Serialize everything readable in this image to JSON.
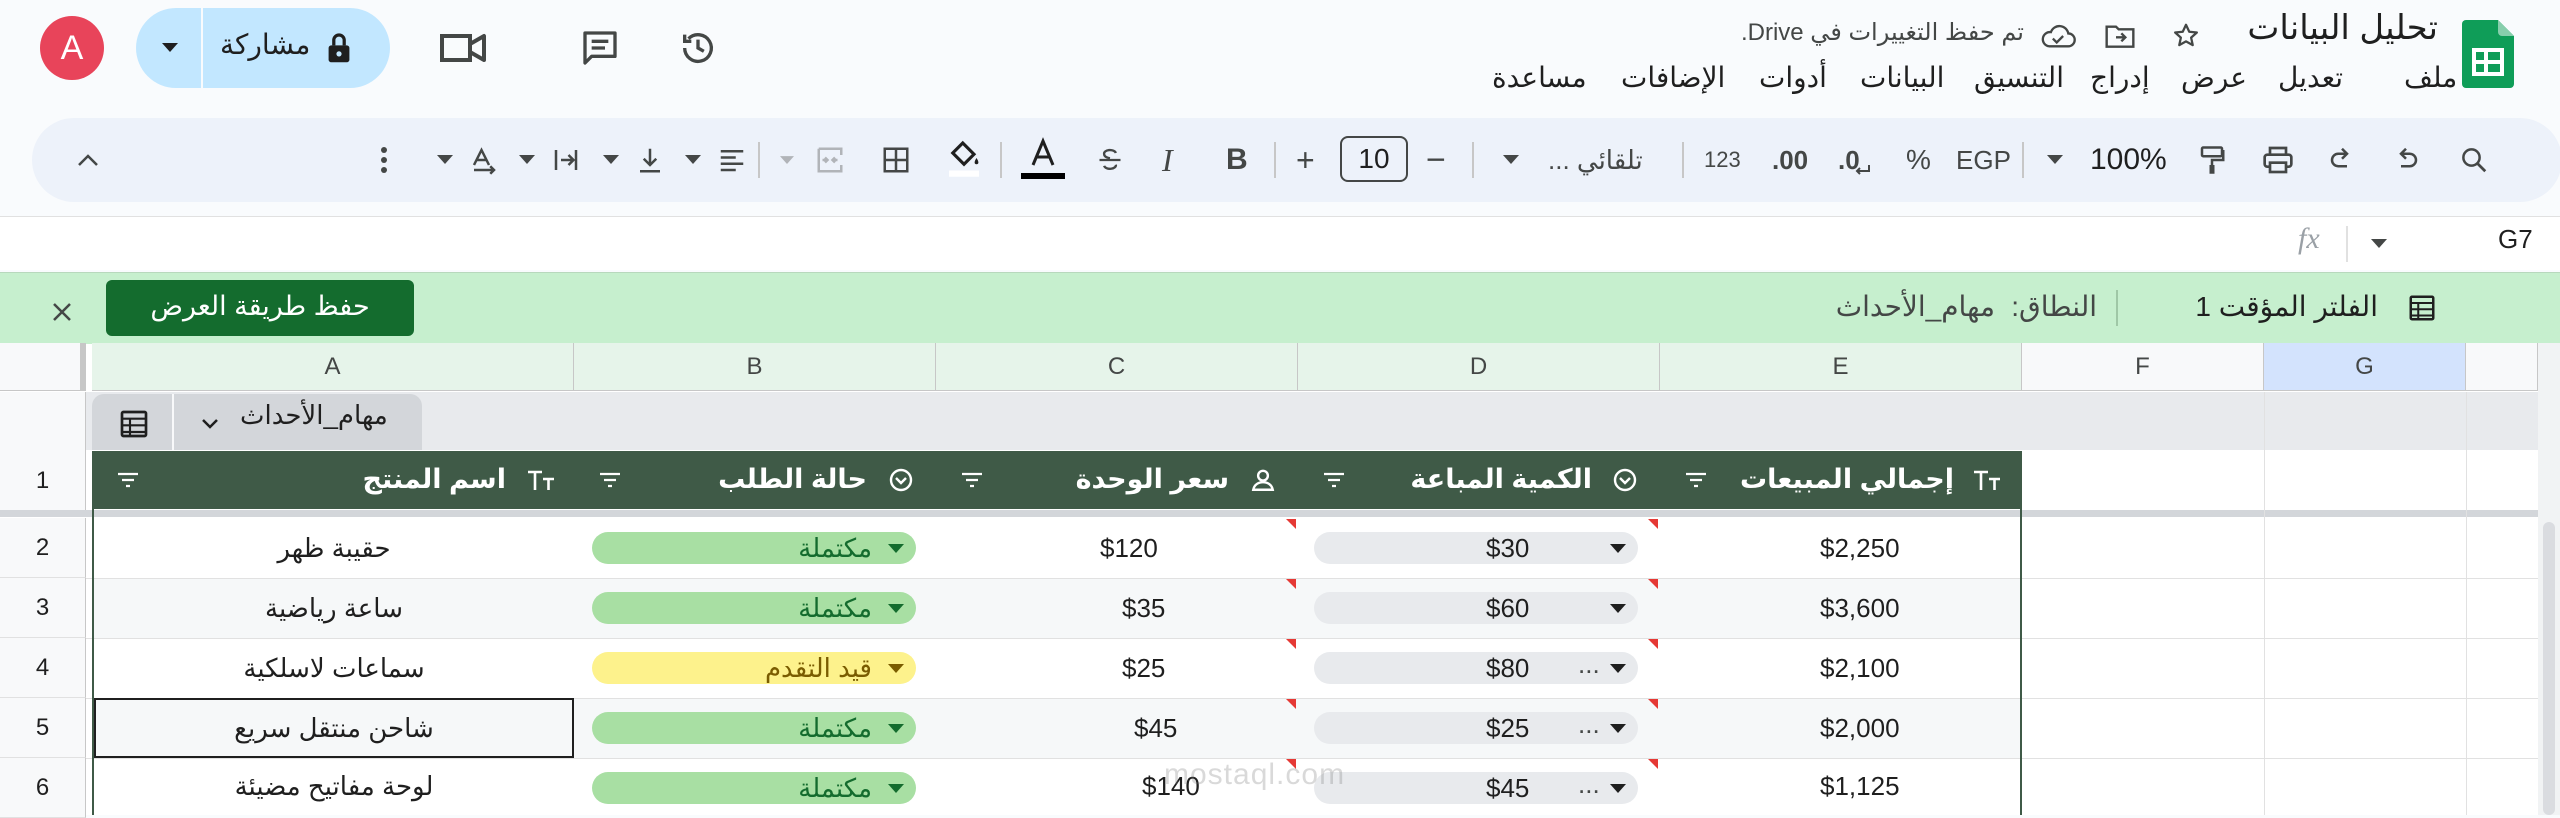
{
  "app": {
    "doc_title": "تحليل البيانات",
    "save_status": "تم حفظ التغييرات في Drive.",
    "share_label": "مشاركة",
    "avatar_letter": "A",
    "menu": [
      "ملف",
      "تعديل",
      "عرض",
      "إدراج",
      "التنسيق",
      "البيانات",
      "أدوات",
      "الإضافات",
      "مساعدة"
    ]
  },
  "toolbar": {
    "zoom": "100%",
    "currency": "EGP",
    "percent": "%",
    "dec_decrease": ".0",
    "dec_increase": ".00",
    "format_123": "123",
    "font": "تلقائي ...",
    "font_size": "10",
    "minus": "−",
    "plus": "+"
  },
  "formula_bar": {
    "cell_ref": "G7",
    "fx": "fx"
  },
  "filter_bar": {
    "filter_name": "الفلتر المؤقت 1",
    "range_label": "النطاق:",
    "range_value": "مهام_الأحداث",
    "save_view_label": "حفظ طريقة العرض"
  },
  "columns": [
    "A",
    "B",
    "C",
    "D",
    "E",
    "F",
    "G"
  ],
  "table": {
    "name": "مهام_الأحداث",
    "headers": {
      "A": "اسم المنتج",
      "B": "حالة الطلب",
      "C": "سعر الوحدة",
      "D": "الكمية المباعة",
      "E": "إجمالي المبيعات"
    },
    "row_numbers": [
      "1",
      "2",
      "3",
      "4",
      "5",
      "6"
    ],
    "rows": [
      {
        "product": "حقيبة ظهر",
        "status": "مكتملة",
        "status_type": "done",
        "price": "$120",
        "qty": "$30",
        "qty_more": "",
        "total": "$2,250"
      },
      {
        "product": "ساعة رياضية",
        "status": "مكتملة",
        "status_type": "done",
        "price": "$35",
        "qty": "$60",
        "qty_more": "",
        "total": "$3,600"
      },
      {
        "product": "سماعات لاسلكية",
        "status": "قيد التقدم",
        "status_type": "progress",
        "price": "$25",
        "qty": "$80",
        "qty_more": "...",
        "total": "$2,100"
      },
      {
        "product": "شاحن منتقل سريع",
        "status": "مكتملة",
        "status_type": "done",
        "price": "$45",
        "qty": "$25",
        "qty_more": "...",
        "total": "$2,000"
      },
      {
        "product": "لوحة مفاتيح مضيئة",
        "status": "مكتملة",
        "status_type": "done",
        "price": "$140",
        "qty": "$45",
        "qty_more": "...",
        "total": "$1,125"
      }
    ]
  },
  "colors": {
    "header_bg": "#3f5a47",
    "filter_bar_bg": "#c6efce",
    "chip_done": "#a8dfa3",
    "chip_progress": "#fdf28c",
    "save_btn": "#146c2e",
    "share_bg": "#c2e7ff",
    "avatar_bg": "#e8445a"
  },
  "watermark": "mostaql.com"
}
